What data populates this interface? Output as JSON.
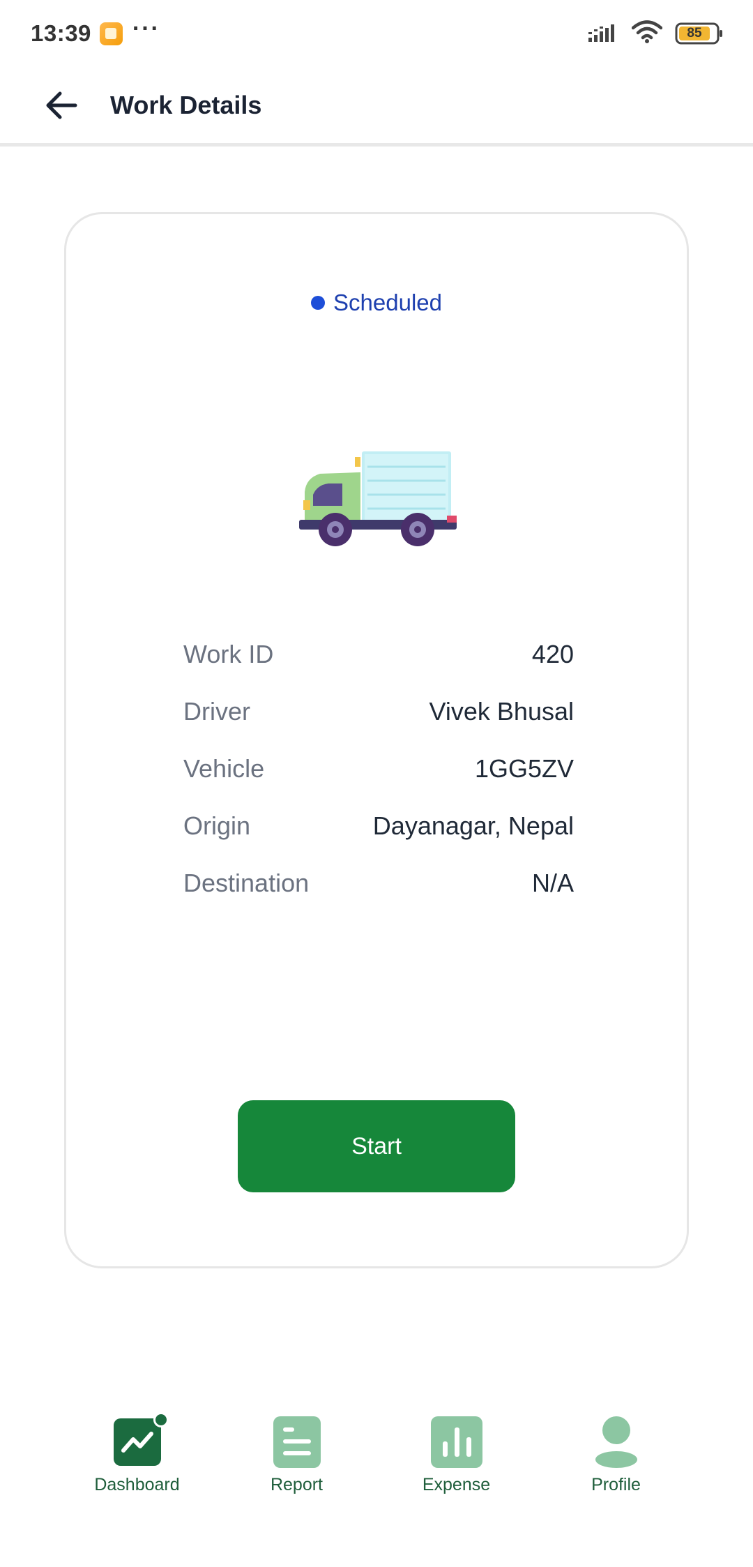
{
  "status_bar": {
    "time": "13:39",
    "battery": "85",
    "icons": [
      "notification-app-icon",
      "signal-icon",
      "wifi-icon",
      "battery-icon"
    ]
  },
  "app_bar": {
    "title": "Work Details",
    "back_icon": "arrow-left-icon"
  },
  "card": {
    "status": "Scheduled",
    "status_color": "#1d4ed8",
    "illustration": "truck-icon",
    "details": [
      {
        "label": "Work ID",
        "value": "420"
      },
      {
        "label": "Driver",
        "value": "Vivek Bhusal"
      },
      {
        "label": "Vehicle",
        "value": "1GG5ZV"
      },
      {
        "label": "Origin",
        "value": "Dayanagar, Nepal"
      },
      {
        "label": "Destination",
        "value": "N/A"
      }
    ],
    "start_label": "Start",
    "start_color": "#16873a"
  },
  "bottom_nav": {
    "items": [
      {
        "label": "Dashboard",
        "icon": "chart-line-icon",
        "active": true
      },
      {
        "label": "Report",
        "icon": "document-icon",
        "active": false
      },
      {
        "label": "Expense",
        "icon": "bar-chart-icon",
        "active": false
      },
      {
        "label": "Profile",
        "icon": "person-icon",
        "active": false
      }
    ],
    "active_color": "#1b6b3f",
    "inactive_color": "#8cc6a2"
  }
}
